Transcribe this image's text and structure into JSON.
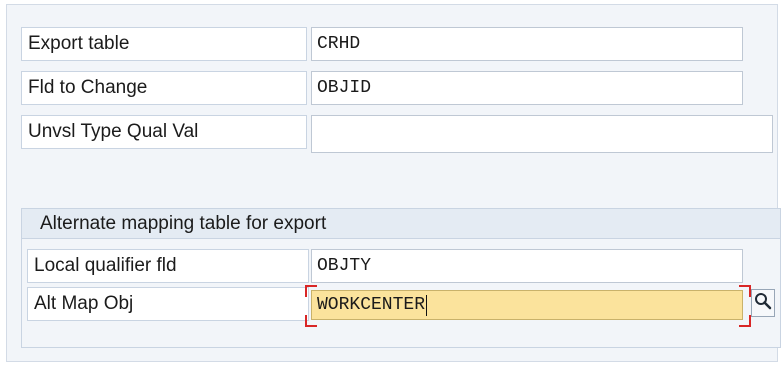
{
  "form": {
    "export_table": {
      "label": "Export table",
      "value": "CRHD"
    },
    "fld_to_change": {
      "label": "Fld to Change",
      "value": "OBJID"
    },
    "unvsl_type_qual_val": {
      "label": "Unvsl Type Qual Val",
      "value": ""
    }
  },
  "alt_mapping": {
    "title": "Alternate mapping table for export",
    "local_qualifier_fld": {
      "label": "Local qualifier fld",
      "value": "OBJTY"
    },
    "alt_map_obj": {
      "label": "Alt Map Obj",
      "value": "WORKCENTER"
    }
  },
  "icons": {
    "value_help": "magnifier-icon"
  },
  "colors": {
    "focus_field_bg": "#fbe39c",
    "focus_corner": "#d92626",
    "panel_bg": "#f2f5f9",
    "group_header_bg": "#e4ebf3"
  }
}
